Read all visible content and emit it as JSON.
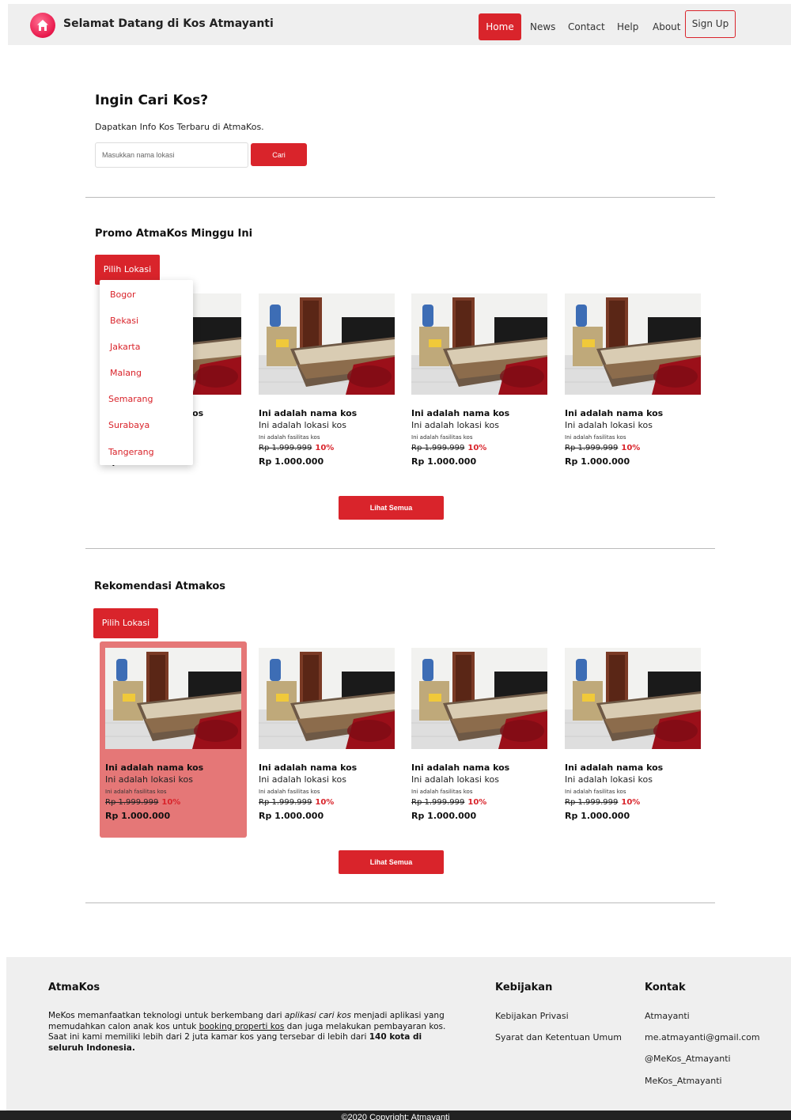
{
  "navbar": {
    "title": "Selamat Datang di Kos Atmayanti",
    "links": [
      "Home",
      "News",
      "Contact",
      "Help",
      "About"
    ],
    "signup": "Sign Up",
    "logo_icon": "house-icon"
  },
  "search": {
    "title": "Ingin Cari Kos?",
    "subtitle": "Dapatkan Info Kos Terbaru di AtmaKos.",
    "placeholder": "Masukkan nama lokasi",
    "button": "Cari"
  },
  "promo": {
    "title": "Promo AtmaKos Minggu Ini",
    "location_button": "Pilih Lokasi",
    "dropdown": [
      "Bogor",
      "Bekasi",
      "Jakarta",
      "Malang",
      "Semarang",
      "Surabaya",
      "Tangerang"
    ],
    "see_all": "Lihat Semua"
  },
  "recommend": {
    "title": "Rekomendasi Atmakos",
    "location_button": "Pilih Lokasi",
    "see_all": "Lihat Semua"
  },
  "card": {
    "name": "Ini adalah nama kos",
    "location": "Ini adalah lokasi kos",
    "facilities": "Ini adalah fasilitas kos",
    "old_price": "Rp 1.999.999",
    "discount": "10%",
    "new_price": "Rp 1.000.000",
    "partial_price": "Rp 1.000.000"
  },
  "footer": {
    "about_title": "AtmaKos",
    "about_parts": {
      "p1": "MeKos memanfaatkan teknologi untuk berkembang dari ",
      "p2": "aplikasi cari kos",
      "p3": " menjadi aplikasi yang memudahkan calon anak kos untuk ",
      "p4": "booking properti kos",
      "p5": " dan juga melakukan pembayaran kos. Saat ini kami memiliki lebih dari 2 juta kamar kos yang tersebar di lebih dari ",
      "p6": "140 kota di seluruh Indonesia."
    },
    "policy_title": "Kebijakan",
    "policy_links": [
      "Kebijakan Privasi",
      "Syarat dan Ketentuan Umum"
    ],
    "contact_title": "Kontak",
    "contact_links": [
      "Atmayanti",
      "me.atmayanti@gmail.com",
      "@MeKos_Atmayanti",
      "MeKos_Atmayanti"
    ]
  },
  "copyright": "©2020 Copyright: Atmayanti",
  "colors": {
    "accent": "#d9242b",
    "highlight": "#e57777",
    "nav_bg": "#efefef"
  }
}
